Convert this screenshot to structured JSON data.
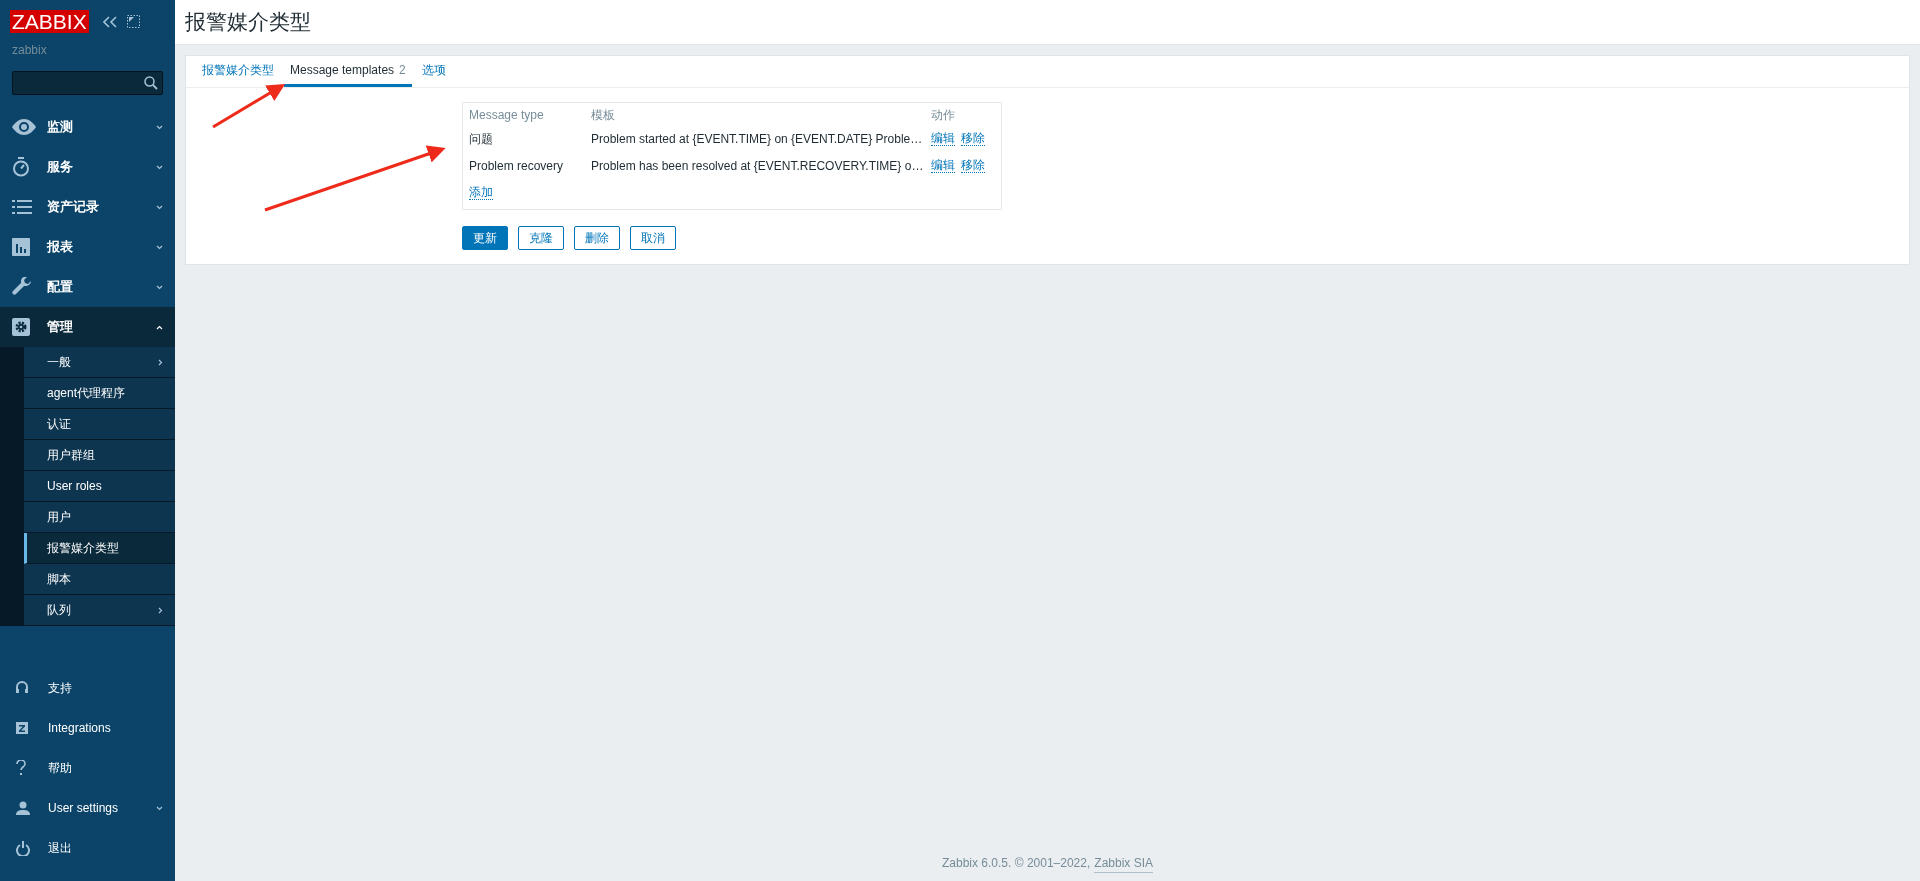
{
  "sidebar": {
    "logo": "ZABBIX",
    "server_name": "zabbix",
    "menu": [
      {
        "label": "监测",
        "expanded": false
      },
      {
        "label": "服务",
        "expanded": false
      },
      {
        "label": "资产记录",
        "expanded": false
      },
      {
        "label": "报表",
        "expanded": false
      },
      {
        "label": "配置",
        "expanded": false
      },
      {
        "label": "管理",
        "expanded": true,
        "children": [
          {
            "label": "一般",
            "selected": false,
            "has_submenu": true
          },
          {
            "label": "agent代理程序",
            "selected": false,
            "has_submenu": false
          },
          {
            "label": "认证",
            "selected": false,
            "has_submenu": false
          },
          {
            "label": "用户群组",
            "selected": false,
            "has_submenu": false
          },
          {
            "label": "User roles",
            "selected": false,
            "has_submenu": false
          },
          {
            "label": "用户",
            "selected": false,
            "has_submenu": false
          },
          {
            "label": "报警媒介类型",
            "selected": true,
            "has_submenu": false
          },
          {
            "label": "脚本",
            "selected": false,
            "has_submenu": false
          },
          {
            "label": "队列",
            "selected": false,
            "has_submenu": true
          }
        ]
      }
    ],
    "bottom_menu": [
      {
        "label": "支持",
        "expandable": false
      },
      {
        "label": "Integrations",
        "expandable": false
      },
      {
        "label": "帮助",
        "expandable": false
      },
      {
        "label": "User settings",
        "expandable": true
      },
      {
        "label": "退出",
        "expandable": false
      }
    ]
  },
  "page_title": "报警媒介类型",
  "tabs": [
    {
      "label": "报警媒介类型",
      "selected": false
    },
    {
      "label": "Message templates",
      "count": "2",
      "selected": true
    },
    {
      "label": "选项",
      "selected": false
    }
  ],
  "table": {
    "columns": [
      "Message type",
      "模板",
      "动作"
    ],
    "rows": [
      {
        "message_type": "问题",
        "template": "Problem started at {EVENT.TIME} on {EVENT.DATE} Proble…",
        "actions": [
          "编辑",
          "移除"
        ]
      },
      {
        "message_type": "Problem recovery",
        "template": "Problem has been resolved at {EVENT.RECOVERY.TIME} o…",
        "actions": [
          "编辑",
          "移除"
        ]
      }
    ],
    "add_link": "添加"
  },
  "buttons": [
    {
      "label": "更新",
      "kind": "primary"
    },
    {
      "label": "克隆",
      "kind": "secondary"
    },
    {
      "label": "删除",
      "kind": "secondary"
    },
    {
      "label": "取消",
      "kind": "secondary"
    }
  ],
  "footer": {
    "text": "Zabbix 6.0.5. © 2001–2022,",
    "link": "Zabbix SIA"
  }
}
